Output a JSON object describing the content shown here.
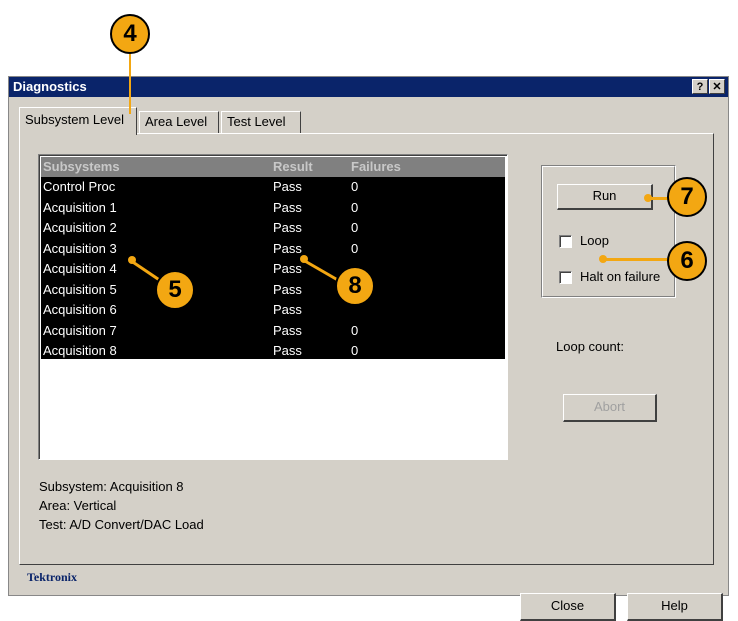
{
  "window": {
    "title": "Diagnostics",
    "help_btn": "?",
    "close_btn": "✕"
  },
  "tabs": [
    {
      "label": "Subsystem Level"
    },
    {
      "label": "Area Level"
    },
    {
      "label": "Test Level"
    }
  ],
  "list": {
    "headers": {
      "col1": "Subsystems",
      "col2": "Result",
      "col3": "Failures"
    },
    "rows": [
      {
        "subsystem": "Control Proc",
        "result": "Pass",
        "failures": "0"
      },
      {
        "subsystem": "Acquisition 1",
        "result": "Pass",
        "failures": "0"
      },
      {
        "subsystem": "Acquisition 2",
        "result": "Pass",
        "failures": "0"
      },
      {
        "subsystem": "Acquisition 3",
        "result": "Pass",
        "failures": "0"
      },
      {
        "subsystem": "Acquisition 4",
        "result": "Pass",
        "failures": ""
      },
      {
        "subsystem": "Acquisition 5",
        "result": "Pass",
        "failures": ""
      },
      {
        "subsystem": "Acquisition 6",
        "result": "Pass",
        "failures": ""
      },
      {
        "subsystem": "Acquisition 7",
        "result": "Pass",
        "failures": "0"
      },
      {
        "subsystem": "Acquisition 8",
        "result": "Pass",
        "failures": "0"
      }
    ]
  },
  "controls": {
    "run_label": "Run",
    "loop_label": "Loop",
    "halt_label": "Halt on failure",
    "loop_count_label": "Loop count:",
    "abort_label": "Abort"
  },
  "info": {
    "subsystem": "Subsystem: Acquisition 8",
    "area": "Area: Vertical",
    "test": "Test: A/D Convert/DAC Load"
  },
  "footer": {
    "brand": "Tektronix",
    "close_label": "Close",
    "help_label": "Help"
  },
  "callouts": {
    "c4": "4",
    "c5": "5",
    "c6": "6",
    "c7": "7",
    "c8": "8"
  },
  "colors": {
    "callout": "#f3a712",
    "titlebar": "#0a246a",
    "dialog": "#d4d0c8"
  }
}
